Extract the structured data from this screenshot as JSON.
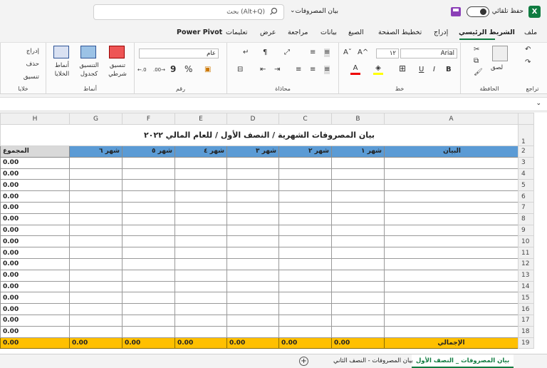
{
  "app": {
    "autosave_label": "حفظ تلقائي",
    "file_name": "بيان المصروفات",
    "search_placeholder": "بحث (Alt+Q)",
    "excel_badge": "X"
  },
  "ribbon_tabs": [
    "ملف",
    "الشريط الرئيسي",
    "إدراج",
    "تخطيط الصفحة",
    "الصيغ",
    "بيانات",
    "مراجعة",
    "عرض",
    "تعليمات",
    "Power Pivot"
  ],
  "groups": {
    "undo": "تراجع",
    "clipboard": "الحافظة",
    "paste": "لصق",
    "font": "خط",
    "align": "محاذاة",
    "number": "رقم",
    "styles": "أنماط",
    "cells": "خلايا"
  },
  "font": {
    "name": "Arial",
    "size": "١٢",
    "bold": "B",
    "italic": "I",
    "underline": "U",
    "grow": "A^",
    "shrink": "Aˇ",
    "font_color": "A"
  },
  "number": {
    "format": "عام",
    "percent": "%",
    "comma": "9"
  },
  "styles": {
    "conditional": "تنسيق شرطي",
    "table": "التنسيق كجدول",
    "cell": "أنماط الخلايا"
  },
  "cells": {
    "insert": "إدراج",
    "delete": "حذف",
    "format": "تنسيق"
  },
  "columns": [
    "A",
    "B",
    "C",
    "D",
    "E",
    "F",
    "G",
    "H"
  ],
  "rows": [
    "1",
    "2",
    "3",
    "4",
    "5",
    "6",
    "7",
    "8",
    "9",
    "10",
    "11",
    "12",
    "13",
    "14",
    "15",
    "16",
    "17",
    "18",
    "19"
  ],
  "sheet": {
    "title": "بيان المصروفات الشهرية / النصف الأول / للعام المالي ٢٠٢٢",
    "header_statement": "البيان",
    "months": [
      "شهر ١",
      "شهر ٢",
      "شهر ٣",
      "شهر ٤",
      "شهر ٥",
      "شهر ٦"
    ],
    "total_header": "المجموع",
    "zero": "0.00",
    "total_label": "الإجمالي"
  },
  "sheet_tabs": [
    "بيان المصروفات _ النصف الأول",
    "بيان المصروفات - النصف الثاني"
  ],
  "colors": {
    "header_blue": "#5b9bd5",
    "total_gold": "#ffc000",
    "accent": "#107c41"
  }
}
